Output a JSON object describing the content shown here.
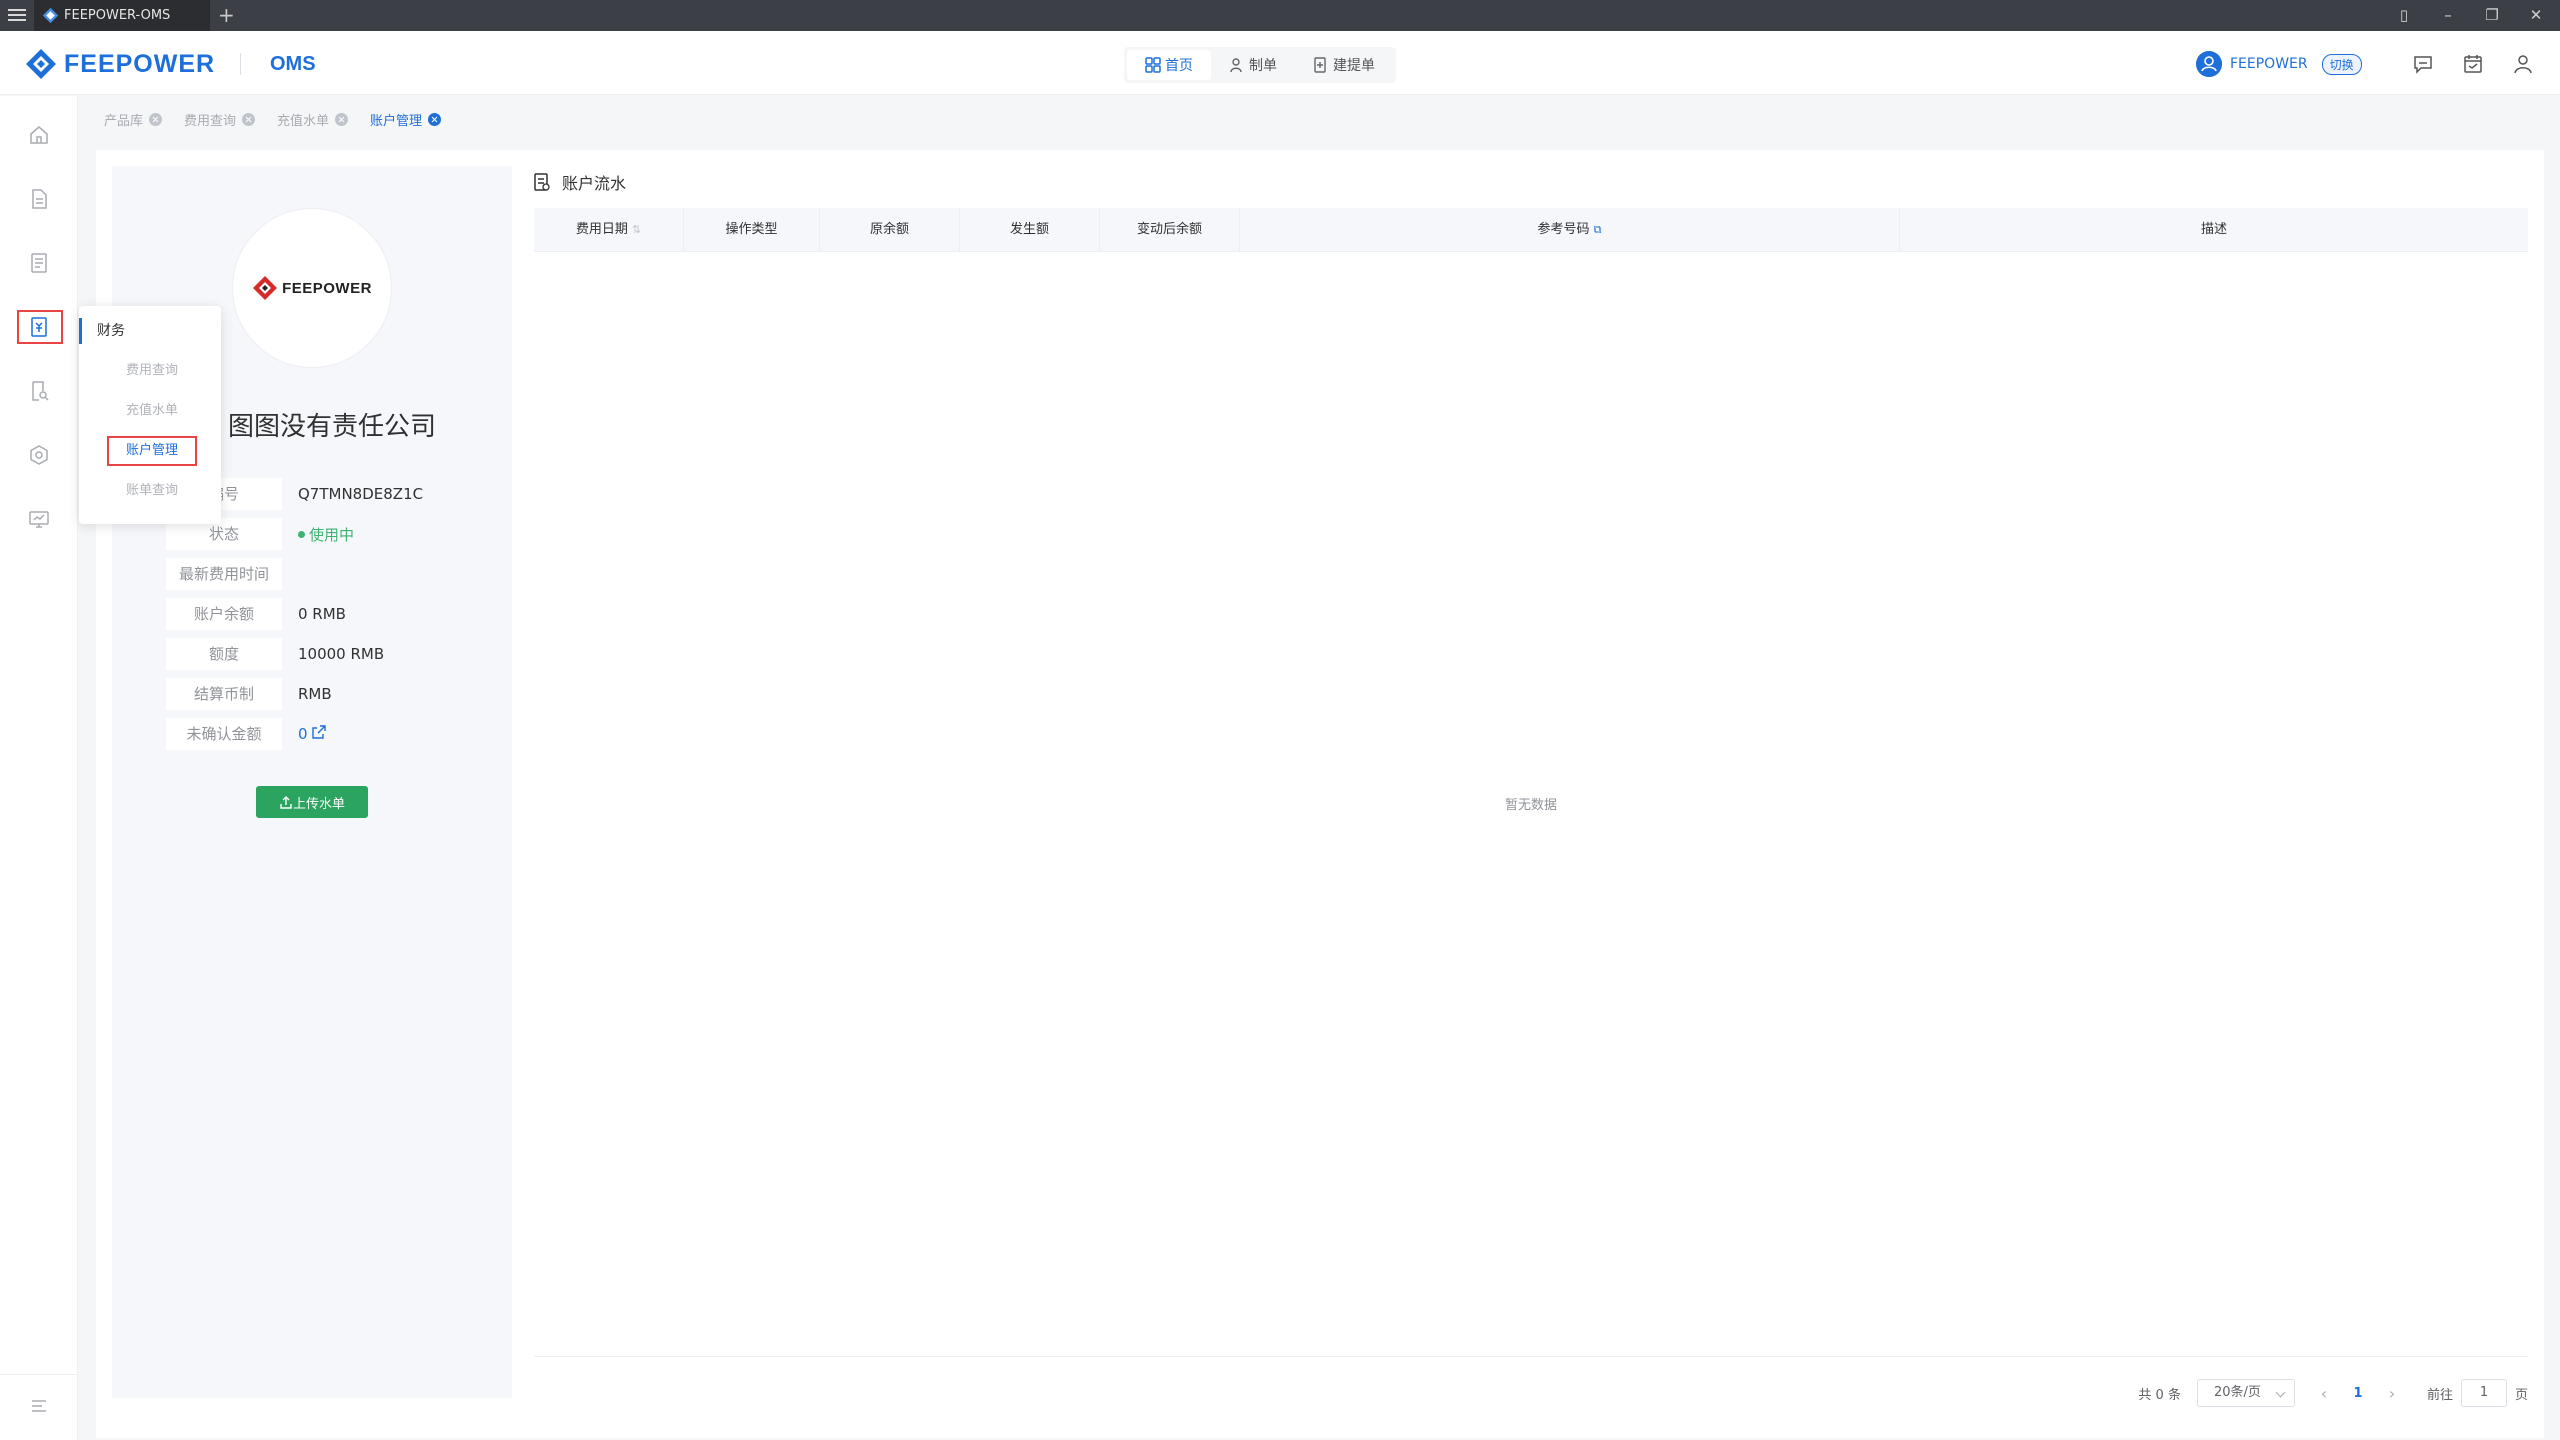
{
  "window": {
    "tab_title": "FEEPOWER-OMS",
    "new_tab": "+"
  },
  "header": {
    "logo_text": "FEEPOWER",
    "product": "OMS",
    "nav": [
      {
        "label": "首页",
        "icon": "grid-icon"
      },
      {
        "label": "制单",
        "icon": "user-doc-icon"
      },
      {
        "label": "建提单",
        "icon": "doc-add-icon"
      }
    ],
    "user_name": "FEEPOWER",
    "switch_label": "切换"
  },
  "sidebar": {
    "icons": [
      "home-icon",
      "document-icon",
      "list-document-icon",
      "finance-icon",
      "search-document-icon",
      "settings-hex-icon",
      "monitor-icon"
    ],
    "active_index": 3
  },
  "flyout": {
    "title": "财务",
    "items": [
      "费用查询",
      "充值水单",
      "账户管理",
      "账单查询"
    ],
    "active_index": 2
  },
  "tabs": [
    {
      "label": "产品库"
    },
    {
      "label": "费用查询"
    },
    {
      "label": "充值水单"
    },
    {
      "label": "账户管理"
    }
  ],
  "account": {
    "logo_text": "FEEPOWER",
    "company": "图图没有责任公司",
    "fields": [
      {
        "label": "编号",
        "value": "Q7TMN8DE8Z1C"
      },
      {
        "label": "状态",
        "value": "使用中"
      },
      {
        "label": "最新费用时间",
        "value": ""
      },
      {
        "label": "账户余额",
        "value": "0 RMB"
      },
      {
        "label": "额度",
        "value": "10000 RMB"
      },
      {
        "label": "结算币制",
        "value": "RMB"
      },
      {
        "label": "未确认金额",
        "value": "0"
      }
    ],
    "upload_button": "上传水单"
  },
  "ledger": {
    "title": "账户流水",
    "columns": [
      "费用日期",
      "操作类型",
      "原余额",
      "发生额",
      "变动后余额",
      "参考号码",
      "描述"
    ],
    "empty_text": "暂无数据",
    "pagination": {
      "total": "共 0 条",
      "page_size": "20条/页",
      "current_page": "1",
      "goto_label": "前往",
      "goto_value": "1",
      "page_unit": "页"
    }
  },
  "colors": {
    "primary": "#1e6fd9",
    "success": "#2aa45f",
    "highlight": "#e94545"
  }
}
